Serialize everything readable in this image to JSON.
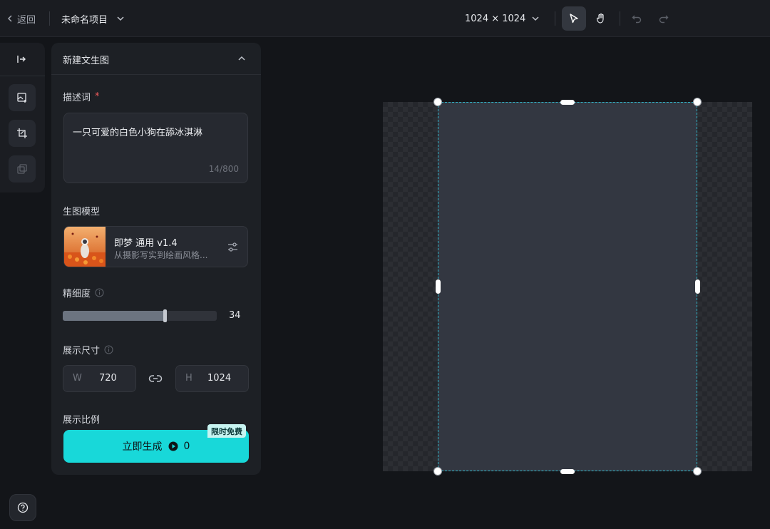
{
  "header": {
    "back_label": "返回",
    "project_name": "未命名项目",
    "canvas_size": "1024 × 1024"
  },
  "panel": {
    "title": "新建文生图",
    "prompt": {
      "label": "描述词",
      "required_mark": "*",
      "value": "一只可爱的白色小狗在舔冰淇淋",
      "counter": "14/800"
    },
    "model": {
      "label": "生图模型",
      "name": "即梦 通用 v1.4",
      "description": "从摄影写实到绘画风格..."
    },
    "detail": {
      "label": "精细度",
      "value": "34",
      "fraction": 0.66
    },
    "display_size": {
      "label": "展示尺寸",
      "width_letter": "W",
      "width": "720",
      "height_letter": "H",
      "height": "1024"
    },
    "ratio": {
      "label": "展示比例"
    },
    "generate": {
      "label": "立即生成",
      "cost": "0",
      "badge": "限时免费"
    }
  },
  "colors": {
    "accent": "#18d8d9",
    "selection": "#2fb6c9",
    "required": "#f05a5a"
  },
  "icons": [
    "chevron-left-icon",
    "chevron-down-icon",
    "pointer-icon",
    "hand-icon",
    "undo-icon",
    "redo-icon",
    "expand-panel-icon",
    "add-image-icon",
    "crop-image-icon",
    "layers-icon",
    "help-icon",
    "chevron-up-icon",
    "info-icon",
    "sliders-icon",
    "link-icon",
    "play-coin-icon"
  ]
}
